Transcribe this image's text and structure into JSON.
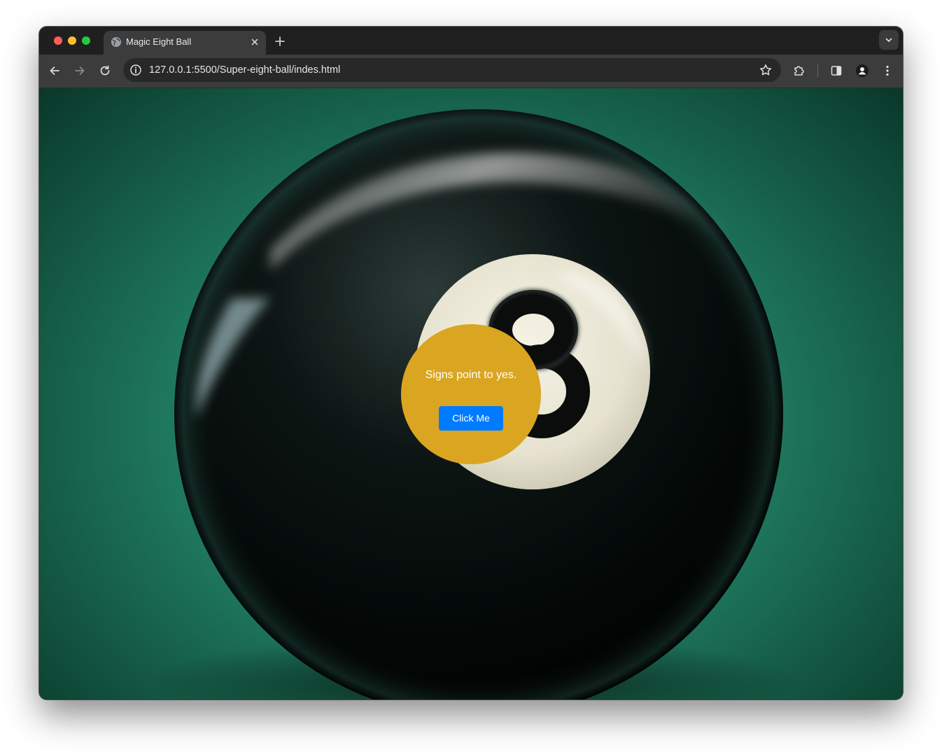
{
  "browser": {
    "tab": {
      "title": "Magic Eight Ball",
      "favicon_icon": "globe-icon",
      "close_icon": "close-icon"
    },
    "new_tab_icon": "plus-icon",
    "tab_search_icon": "chevron-down-icon",
    "nav": {
      "back_icon": "arrow-left-icon",
      "forward_icon": "arrow-right-icon",
      "reload_icon": "reload-icon"
    },
    "address_bar": {
      "url": "127.0.0.1:5500/Super-eight-ball/indes.html",
      "info_icon": "info-icon",
      "bookmark_icon": "star-icon"
    },
    "toolbar_icons": [
      "puzzle-icon",
      "side-panel-icon",
      "profile-icon",
      "more-vert-icon"
    ]
  },
  "page": {
    "answer": "Signs point to yes.",
    "button_label": "Click Me",
    "colors": {
      "ball": "#daa520",
      "button": "#007bff",
      "button_text": "#ffffff",
      "answer_text": "#ffffff"
    }
  }
}
